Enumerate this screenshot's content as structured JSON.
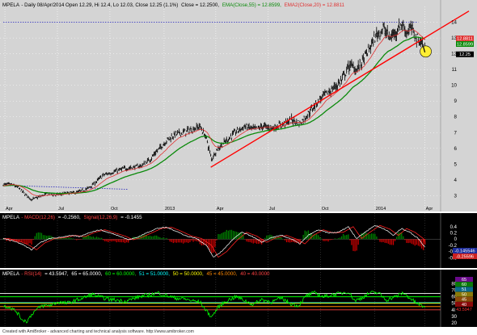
{
  "colors": {
    "price_bg": "#d4d4d4",
    "panel_bg": "#000000",
    "price": "#000000",
    "ema55": "#0a8a0a",
    "ema20": "#e03030",
    "trendline": "#ff0000",
    "hline": "#2222bb",
    "macd": "#ffffff",
    "signal": "#ff2020",
    "hist_up": "#008000",
    "hist_down": "#cc0000",
    "rsi": "#00ff00",
    "grid": "#ffffff",
    "marker": "#ffee33"
  },
  "header": {
    "ticker": "MPELA",
    "info": "- Daily 08/Apr/2014 Open 12.29, Hi 12.4, Lo 12.03, Close 12.25 (1.1%)",
    "close_label": "Close = 12.2500,",
    "ema55_label": "EMA(Close,55) = 12.8599,",
    "ema20_label": "EMA2(Close,20) = 12.8811"
  },
  "macd_header": {
    "ticker": "MPELA",
    "macd_label": "- MACD(12,26)",
    "macd_value": "= -0.2560,",
    "signal_label": "Signal(12,26,9)",
    "signal_value": "= -0.1455"
  },
  "rsi_header": {
    "ticker": "MPELA",
    "rsi_label": "- RSI(14)",
    "rsi_value": "= 43.5947,",
    "l65": "65 = 65.0000,",
    "l60": "60 = 60.0000,",
    "l51": "51 = 51.0000,",
    "l50": "50 = 50.0000,",
    "l45": "45 = 45.0000,",
    "l40": "40 = 40.0000"
  },
  "footer": "Created with AmiBroker - advanced charting and technical analysis software. http://www.amibroker.com",
  "price_badges": {
    "ema20": "12.8811",
    "ema55": "12.8599",
    "close": "12.25"
  },
  "macd_badges": {
    "signal": "-0.145546",
    "macd": "-0.25596"
  },
  "rsi_badges": {
    "l65": "65",
    "l60": "60",
    "l51": "51",
    "l50": "50",
    "l45": "45",
    "l40": "40",
    "rsi": "43.5947"
  },
  "chart_data": [
    {
      "type": "line",
      "panel": "price",
      "x_ticks": [
        "Apr",
        "Jul",
        "Oct",
        "2013",
        "Apr",
        "Jul",
        "Oct",
        "2014",
        "Apr"
      ],
      "x_tick_bars": [
        2,
        65,
        128,
        193,
        255,
        318,
        381,
        446,
        506
      ],
      "n_bars": 520,
      "ylim": [
        2.3,
        14.8
      ],
      "y_ticks": [
        3,
        4,
        5,
        6,
        7,
        8,
        9,
        10,
        11,
        12,
        13,
        14
      ],
      "price_anchors": [
        [
          0,
          3.7
        ],
        [
          10,
          3.7
        ],
        [
          18,
          3.5
        ],
        [
          26,
          3.1
        ],
        [
          34,
          2.75
        ],
        [
          42,
          2.9
        ],
        [
          52,
          3.1
        ],
        [
          64,
          3.05
        ],
        [
          76,
          3.15
        ],
        [
          88,
          3.2
        ],
        [
          100,
          3.4
        ],
        [
          110,
          3.8
        ],
        [
          120,
          4.3
        ],
        [
          132,
          4.5
        ],
        [
          144,
          4.7
        ],
        [
          156,
          4.8
        ],
        [
          166,
          4.9
        ],
        [
          176,
          5.3
        ],
        [
          186,
          5.9
        ],
        [
          196,
          6.5
        ],
        [
          206,
          6.9
        ],
        [
          216,
          7.0
        ],
        [
          226,
          7.2
        ],
        [
          236,
          7.4
        ],
        [
          244,
          6.6
        ],
        [
          250,
          5.3
        ],
        [
          256,
          5.9
        ],
        [
          266,
          6.4
        ],
        [
          278,
          7.0
        ],
        [
          290,
          7.4
        ],
        [
          302,
          7.2
        ],
        [
          312,
          7.4
        ],
        [
          322,
          7.3
        ],
        [
          334,
          7.5
        ],
        [
          346,
          7.8
        ],
        [
          356,
          7.6
        ],
        [
          366,
          8.2
        ],
        [
          376,
          8.9
        ],
        [
          386,
          9.4
        ],
        [
          396,
          9.8
        ],
        [
          406,
          10.3
        ],
        [
          416,
          11.3
        ],
        [
          424,
          11.0
        ],
        [
          432,
          11.6
        ],
        [
          440,
          12.4
        ],
        [
          448,
          13.2
        ],
        [
          456,
          13.6
        ],
        [
          464,
          13.0
        ],
        [
          472,
          13.5
        ],
        [
          478,
          13.9
        ],
        [
          484,
          13.4
        ],
        [
          490,
          13.6
        ],
        [
          496,
          13.0
        ],
        [
          502,
          12.7
        ],
        [
          506,
          12.25
        ]
      ],
      "ema55_label": "EMA(Close,55)",
      "ema20_label": "EMA2(Close,20)",
      "trendline": [
        [
          249,
          4.8
        ],
        [
          520,
          14.2
        ]
      ],
      "resistance_line": {
        "from_bar": 0,
        "to_bar": 498,
        "y": 14.0
      },
      "support_line": {
        "points": [
          [
            2,
            3.65
          ],
          [
            150,
            3.4
          ]
        ]
      },
      "marker_bar": 505
    },
    {
      "type": "line",
      "panel": "macd",
      "ylim": [
        -0.9,
        0.55
      ],
      "y_ticks": [
        -0.6,
        -0.4,
        -0.2,
        0,
        0.2,
        0.4
      ],
      "anchors": [
        [
          0,
          0.02
        ],
        [
          12,
          -0.05
        ],
        [
          24,
          -0.18
        ],
        [
          34,
          -0.34
        ],
        [
          44,
          -0.12
        ],
        [
          56,
          0.02
        ],
        [
          68,
          0.05
        ],
        [
          80,
          0.12
        ],
        [
          92,
          0.08
        ],
        [
          104,
          0.22
        ],
        [
          116,
          0.3
        ],
        [
          128,
          0.2
        ],
        [
          140,
          0.1
        ],
        [
          150,
          -0.02
        ],
        [
          160,
          0.05
        ],
        [
          172,
          0.2
        ],
        [
          184,
          0.34
        ],
        [
          196,
          0.38
        ],
        [
          208,
          0.25
        ],
        [
          220,
          0.1
        ],
        [
          232,
          0.02
        ],
        [
          244,
          -0.2
        ],
        [
          252,
          -0.58
        ],
        [
          262,
          -0.4
        ],
        [
          274,
          -0.05
        ],
        [
          286,
          0.22
        ],
        [
          298,
          0.1
        ],
        [
          310,
          -0.1
        ],
        [
          322,
          0.05
        ],
        [
          334,
          0.12
        ],
        [
          346,
          0.0
        ],
        [
          356,
          -0.15
        ],
        [
          366,
          0.12
        ],
        [
          378,
          0.3
        ],
        [
          390,
          0.2
        ],
        [
          402,
          0.22
        ],
        [
          414,
          0.4
        ],
        [
          424,
          0.02
        ],
        [
          434,
          0.22
        ],
        [
          446,
          0.44
        ],
        [
          458,
          0.32
        ],
        [
          468,
          0.12
        ],
        [
          478,
          0.34
        ],
        [
          488,
          0.22
        ],
        [
          498,
          0.02
        ],
        [
          506,
          -0.256
        ]
      ],
      "signal_lag": 6
    },
    {
      "type": "line",
      "panel": "rsi",
      "ylim": [
        15,
        88
      ],
      "y_ticks": [
        20,
        30,
        40,
        50,
        60,
        70,
        80
      ],
      "levels": [
        65,
        60,
        51,
        50,
        45,
        40
      ],
      "level_colors": [
        "#ffffff",
        "#00ff00",
        "#00ffff",
        "#ffff00",
        "#ff8800",
        "#ff4040"
      ],
      "anchors": [
        [
          0,
          46
        ],
        [
          8,
          44
        ],
        [
          16,
          37
        ],
        [
          22,
          26
        ],
        [
          28,
          22
        ],
        [
          36,
          36
        ],
        [
          46,
          46
        ],
        [
          56,
          47
        ],
        [
          66,
          52
        ],
        [
          76,
          50
        ],
        [
          86,
          54
        ],
        [
          96,
          58
        ],
        [
          106,
          64
        ],
        [
          116,
          60
        ],
        [
          126,
          56
        ],
        [
          136,
          55
        ],
        [
          146,
          53
        ],
        [
          156,
          57
        ],
        [
          166,
          61
        ],
        [
          176,
          63
        ],
        [
          186,
          66
        ],
        [
          196,
          62
        ],
        [
          206,
          58
        ],
        [
          216,
          57
        ],
        [
          226,
          54
        ],
        [
          236,
          52
        ],
        [
          244,
          38
        ],
        [
          250,
          29
        ],
        [
          258,
          44
        ],
        [
          268,
          54
        ],
        [
          280,
          60
        ],
        [
          290,
          54
        ],
        [
          300,
          48
        ],
        [
          310,
          56
        ],
        [
          322,
          52
        ],
        [
          334,
          58
        ],
        [
          344,
          50
        ],
        [
          354,
          46
        ],
        [
          364,
          62
        ],
        [
          374,
          66
        ],
        [
          384,
          60
        ],
        [
          394,
          63
        ],
        [
          404,
          65
        ],
        [
          414,
          68
        ],
        [
          422,
          54
        ],
        [
          430,
          58
        ],
        [
          440,
          66
        ],
        [
          450,
          66
        ],
        [
          460,
          55
        ],
        [
          470,
          60
        ],
        [
          480,
          66
        ],
        [
          488,
          58
        ],
        [
          496,
          50
        ],
        [
          502,
          46
        ],
        [
          506,
          43.59
        ]
      ]
    }
  ]
}
